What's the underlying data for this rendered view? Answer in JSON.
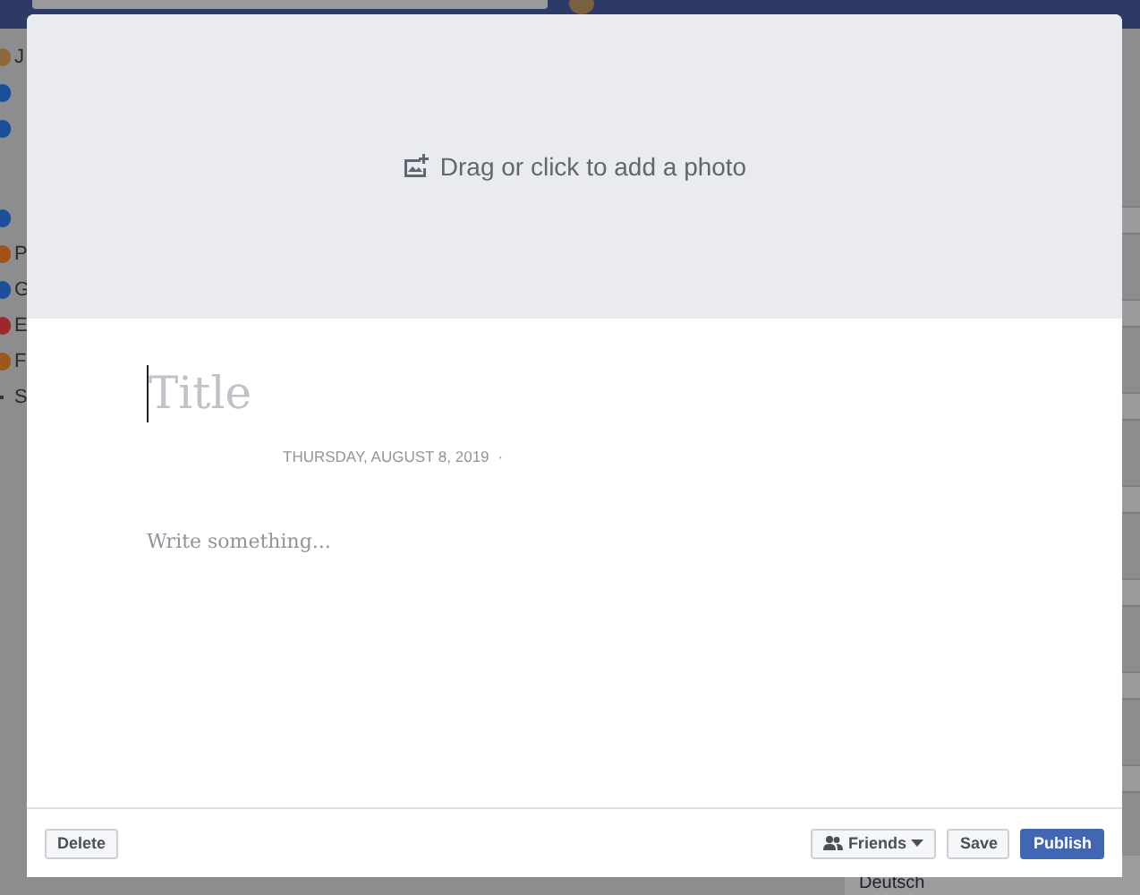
{
  "background": {
    "sidebar": [
      {
        "kind": "item",
        "label": "J",
        "color": "#8a6a3a"
      },
      {
        "kind": "item",
        "color": "#1a4f9a"
      },
      {
        "kind": "item",
        "color": "#1a4f9a"
      },
      {
        "kind": "gap"
      },
      {
        "kind": "item",
        "color": "#1a4f9a"
      },
      {
        "kind": "item",
        "label": "P",
        "color": "#a0521a"
      },
      {
        "kind": "item",
        "label": "G",
        "color": "#1a4f9a"
      },
      {
        "kind": "item",
        "label": "E",
        "color": "#9a2a2a"
      },
      {
        "kind": "item",
        "label": "F",
        "color": "#9a5a1a"
      },
      {
        "kind": "more",
        "label": "S"
      }
    ],
    "language": "Deutsch"
  },
  "dialog": {
    "photo_prompt": "Drag or click to add a photo",
    "title_placeholder": "Title",
    "date": "THURSDAY, AUGUST 8, 2019",
    "date_separator": "·",
    "body_placeholder": "Write something...",
    "delete": "Delete",
    "audience": "Friends",
    "save": "Save",
    "publish": "Publish"
  }
}
